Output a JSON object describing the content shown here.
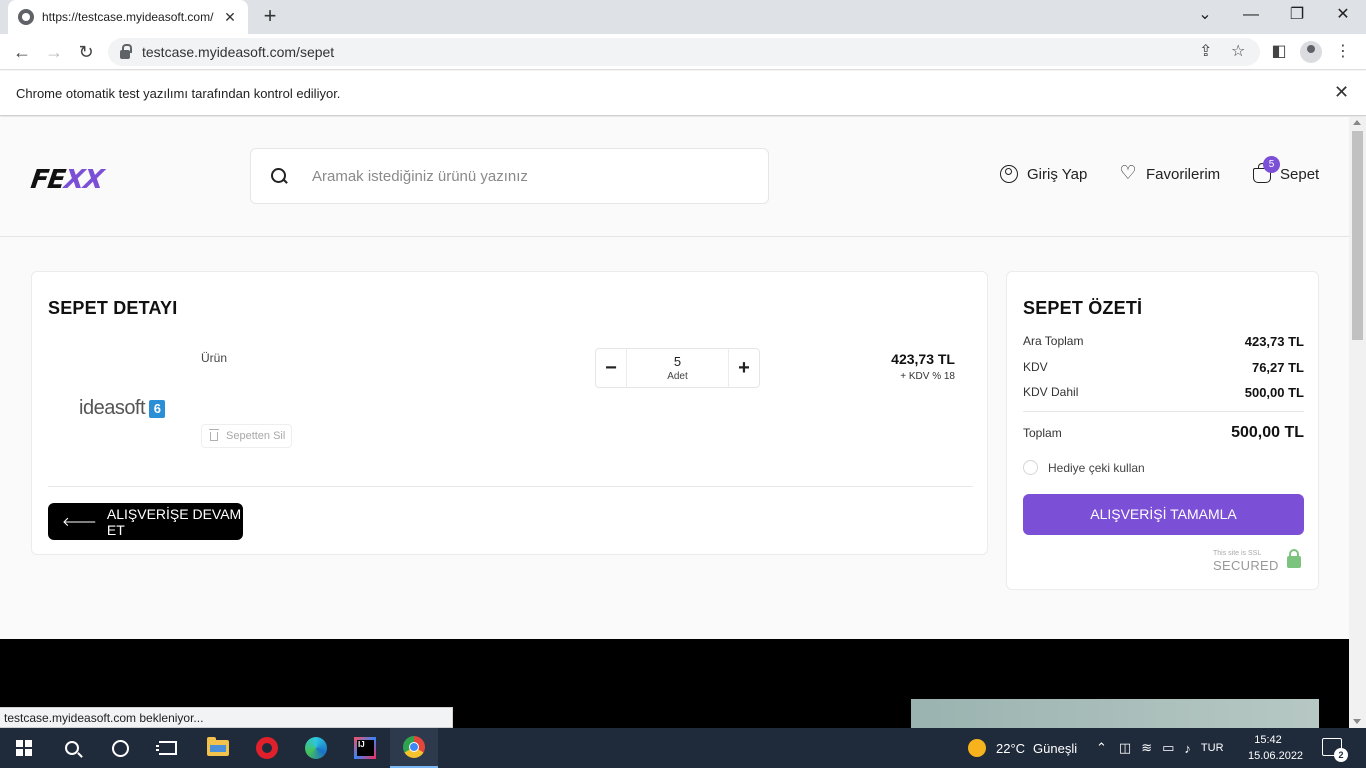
{
  "browser": {
    "tab_title": "https://testcase.myideasoft.com/",
    "tab_close": "✕",
    "new_tab": "+",
    "url": "testcase.myideasoft.com/sepet",
    "infobar_message": "Chrome otomatik test yazılımı tarafından kontrol ediliyor.",
    "status_text": "testcase.myideasoft.com bekleniyor...",
    "icons": [
      "globe-icon",
      "back-icon",
      "forward-icon",
      "reload-icon",
      "lock-icon",
      "share-icon",
      "star-icon",
      "side-panel-icon",
      "profile-icon",
      "menu-icon"
    ]
  },
  "header": {
    "logo_main": "FE",
    "logo_accent": "XX",
    "search_placeholder": "Aramak istediğiniz ürünü yazınız",
    "login_label": "Giriş Yap",
    "favorites_label": "Favorilerim",
    "cart_label": "Sepet",
    "cart_count": "5"
  },
  "detail": {
    "title": "SEPET DETAYI",
    "product_logo_text": "ideasoft",
    "product_logo_badge": "6",
    "product_label": "Ürün",
    "remove_label": "Sepetten Sil",
    "quantity": "5",
    "quantity_unit": "Adet",
    "minus": "−",
    "plus": "+",
    "price": "423,73 TL",
    "vat_note": "+ KDV % 18",
    "continue_label": "ALIŞVERİŞE DEVAM ET",
    "continue_arrow": "🡐"
  },
  "summary": {
    "title": "SEPET ÖZETİ",
    "rows": [
      {
        "label": "Ara Toplam",
        "value": "423,73 TL"
      },
      {
        "label": "KDV",
        "value": "76,27 TL"
      },
      {
        "label": "KDV Dahil",
        "value": "500,00 TL"
      }
    ],
    "total_label": "Toplam",
    "total_value": "500,00 TL",
    "gift_label": "Hediye çeki kullan",
    "complete_label": "ALIŞVERİŞİ TAMAMLA",
    "ssl_top": "This site is SSL",
    "ssl_bottom": "SECURED"
  },
  "taskbar": {
    "weather_temp": "22°C",
    "weather_desc": "Güneşli",
    "language": "TUR",
    "time": "15:42",
    "date": "15.06.2022",
    "notification_count": "2",
    "tray_up": "⌃"
  },
  "colors": {
    "accent": "#7b4fd6",
    "dark_button": "#000000",
    "taskbar": "#1f2a3a"
  }
}
